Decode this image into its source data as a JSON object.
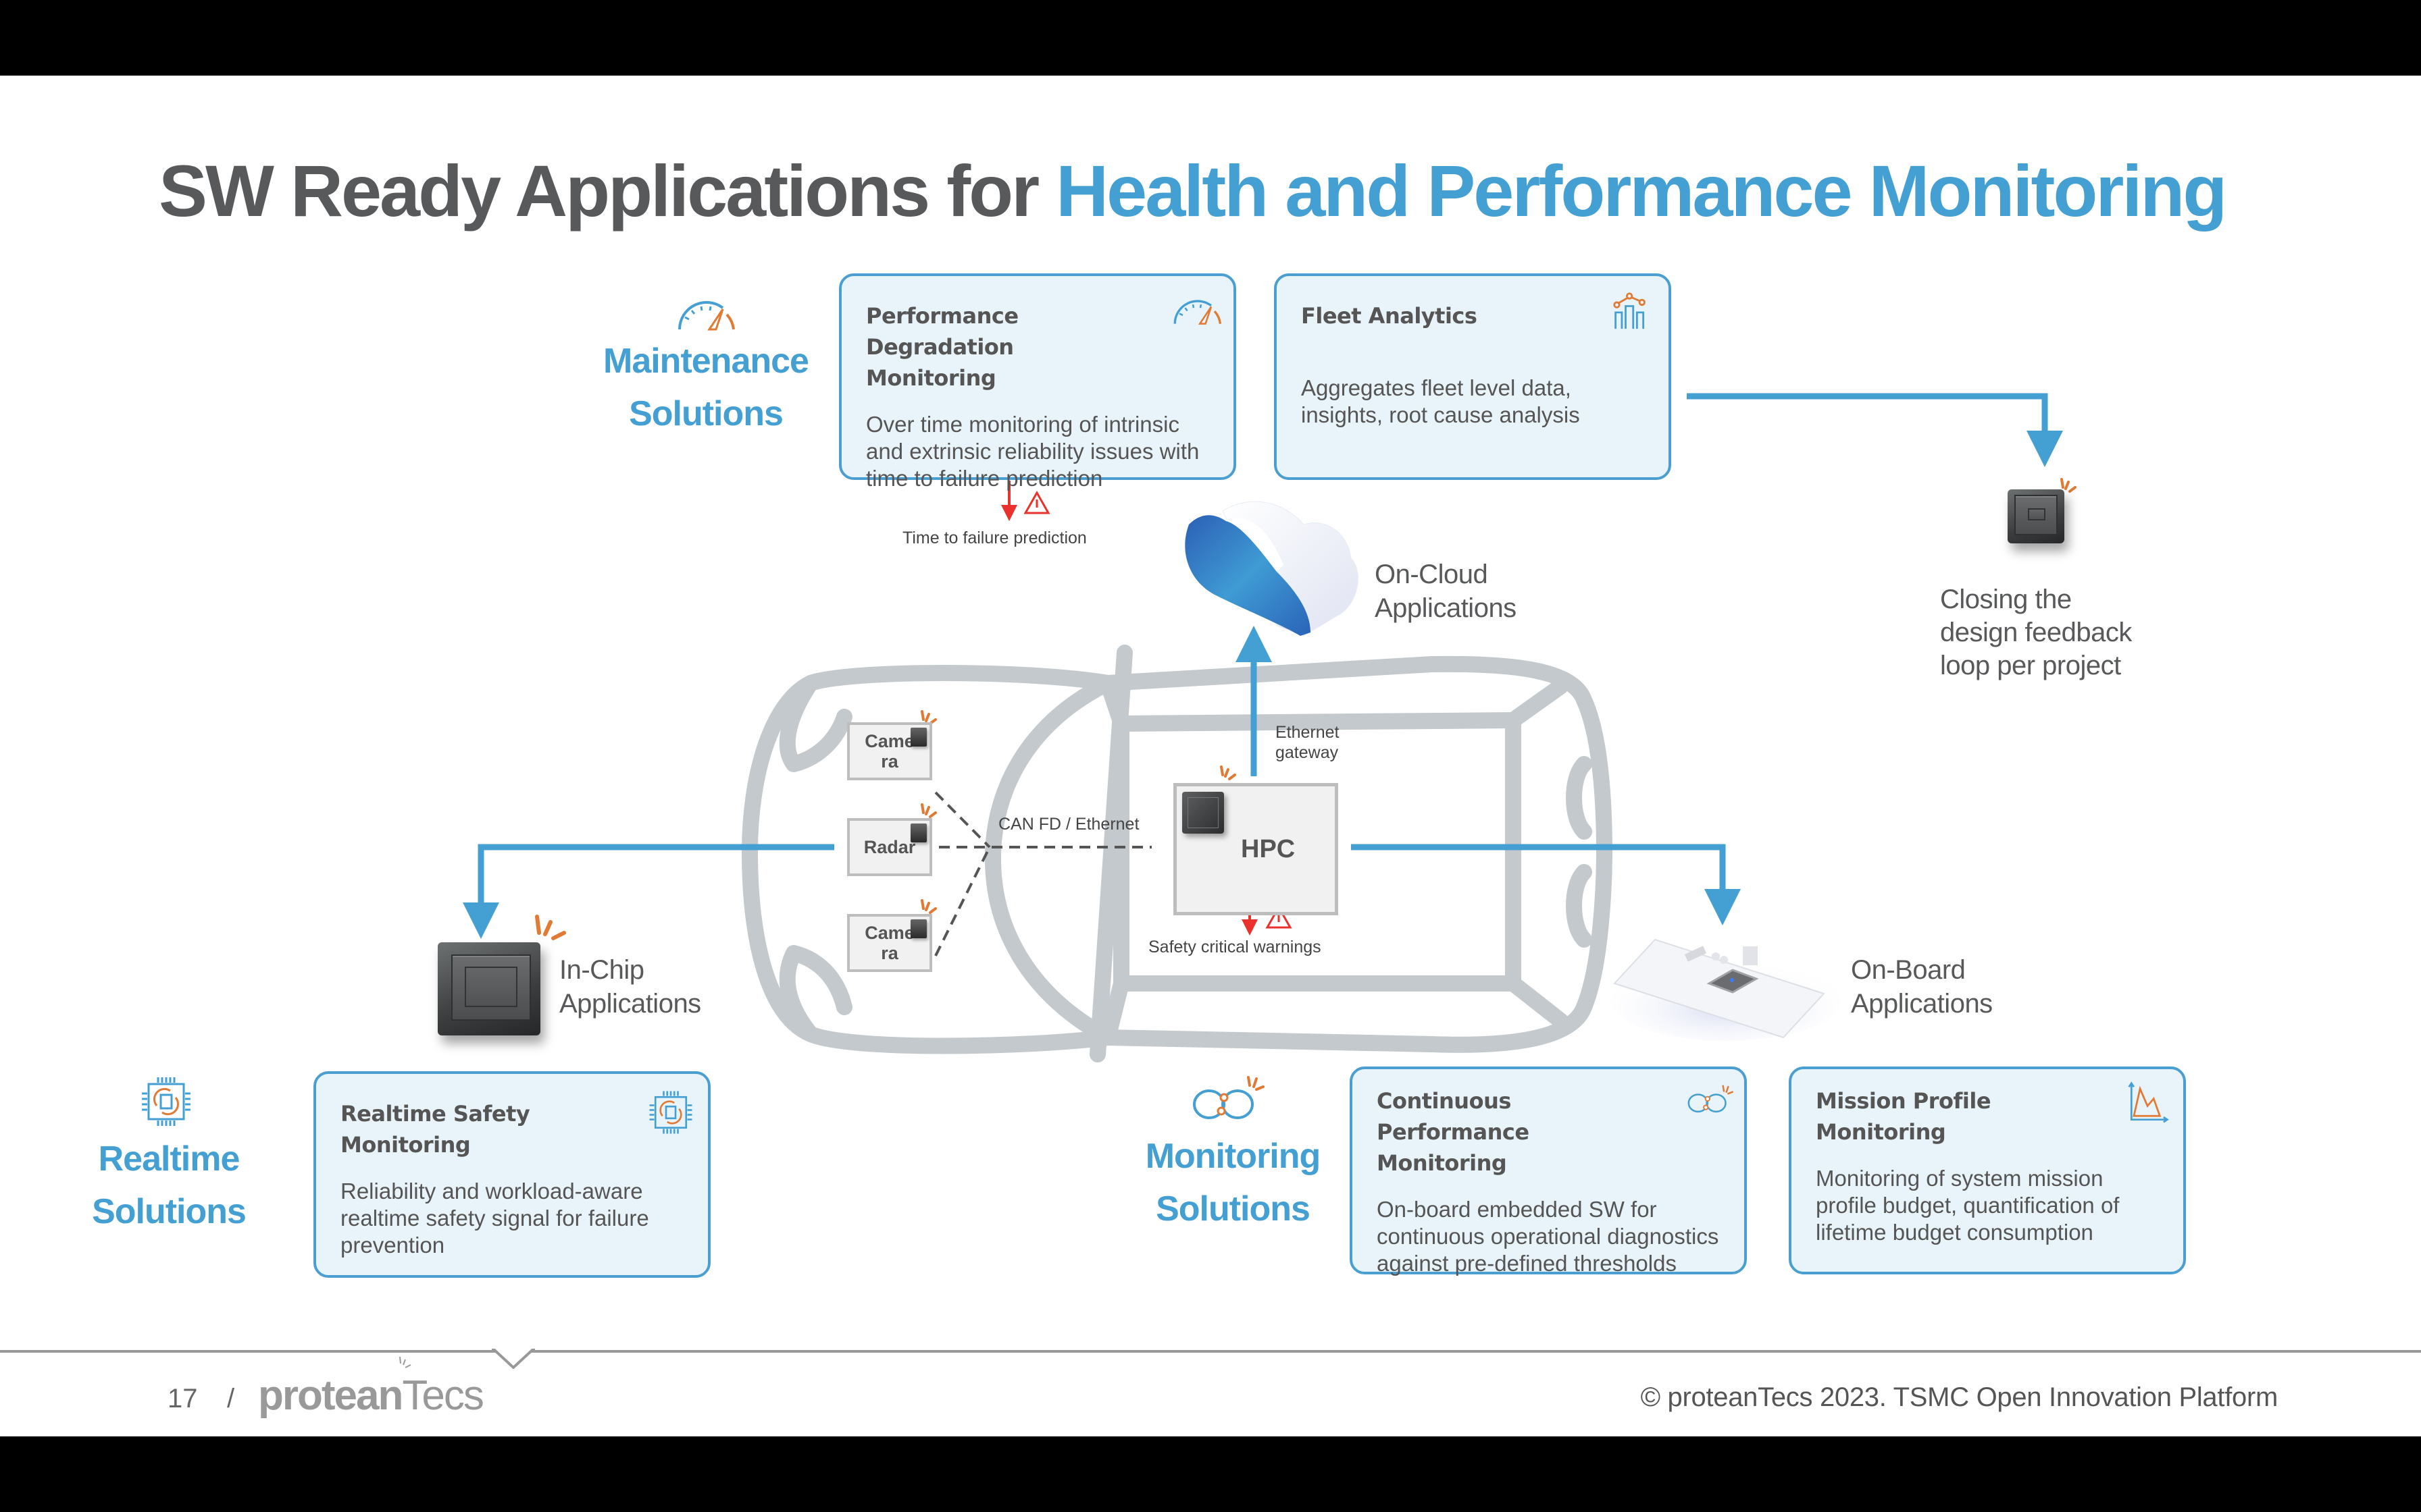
{
  "slide": {
    "title_part1": "SW Ready Applications for ",
    "title_part2": "Health and Performance Monitoring",
    "colors": {
      "accent_blue": "#449fd2",
      "title_gray": "#58595b",
      "card_bg": "#e9f4fa",
      "card_border": "#4a9fd0",
      "alert_red": "#e8322b",
      "spark_orange": "#e07a34",
      "car_outline": "#c3c9cc"
    }
  },
  "solutions": {
    "maintenance": {
      "line1": "Maintenance",
      "line2": "Solutions",
      "icon": "speedometer-icon"
    },
    "realtime": {
      "line1": "Realtime",
      "line2": "Solutions",
      "icon": "chip-cycle-icon"
    },
    "monitoring": {
      "line1": "Monitoring",
      "line2": "Solutions",
      "icon": "infinity-loop-icon"
    }
  },
  "cards": {
    "performance_degradation": {
      "title": "Performance Degradation Monitoring",
      "description": "Over time monitoring of intrinsic and extrinsic reliability issues with time to failure prediction",
      "icon": "speedometer-icon"
    },
    "fleet_analytics": {
      "title": "Fleet Analytics",
      "description": "Aggregates fleet level data, insights, root cause analysis",
      "icon": "bar-chart-nodes-icon"
    },
    "realtime_safety": {
      "title": "Realtime Safety Monitoring",
      "description": "Reliability and workload-aware realtime safety signal for failure prevention",
      "icon": "chip-cycle-icon"
    },
    "continuous_performance": {
      "title": "Continuous Performance Monitoring",
      "description": "On-board embedded SW for continuous operational diagnostics against pre-defined thresholds",
      "icon": "infinity-loop-icon"
    },
    "mission_profile": {
      "title": "Mission Profile Monitoring",
      "description": "Monitoring of system mission profile budget, quantification of lifetime budget consumption",
      "icon": "area-chart-icon"
    }
  },
  "applications": {
    "on_cloud": {
      "line1": "On-Cloud",
      "line2": "Applications"
    },
    "in_chip": {
      "line1": "In-Chip",
      "line2": "Applications"
    },
    "on_board": {
      "line1": "On-Board",
      "line2": "Applications"
    },
    "feedback": {
      "line1": "Closing the",
      "line2": "design feedback",
      "line3": "loop per project"
    }
  },
  "diagram": {
    "time_to_failure": "Time to failure prediction",
    "safety_warnings": "Safety critical warnings",
    "bus_label": "CAN FD / Ethernet",
    "gateway_line1": "Ethernet",
    "gateway_line2": "gateway",
    "hpc": "HPC",
    "sensors": [
      {
        "line1": "Came",
        "line2": "ra"
      },
      {
        "line1": "Radar",
        "line2": ""
      },
      {
        "line1": "Came",
        "line2": "ra"
      }
    ]
  },
  "footer": {
    "page_number": "17",
    "separator": "/",
    "logo_bold": "protean",
    "logo_light": "Tecs",
    "copyright": "© proteanTecs 2023. TSMC Open Innovation Platform"
  }
}
